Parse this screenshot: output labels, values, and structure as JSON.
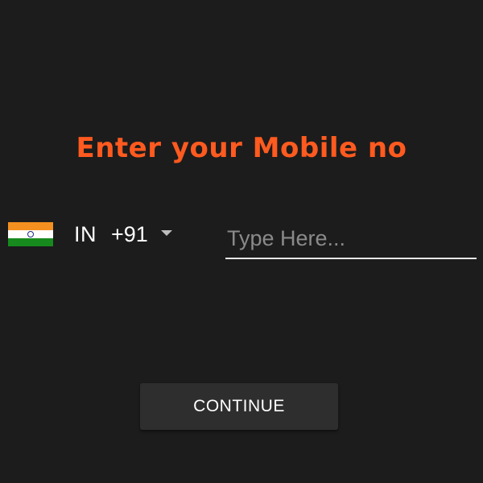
{
  "title": "Enter your Mobile no",
  "country": {
    "flag_icon": "india-flag-icon",
    "code": "IN",
    "dial_code": "+91",
    "dropdown_icon": "caret-down-icon"
  },
  "phone_input": {
    "value": "",
    "placeholder": "Type Here..."
  },
  "continue_label": "CONTINUE",
  "colors": {
    "background": "#1c1c1c",
    "title": "#ff5a1f",
    "button": "#2e2e2e"
  }
}
